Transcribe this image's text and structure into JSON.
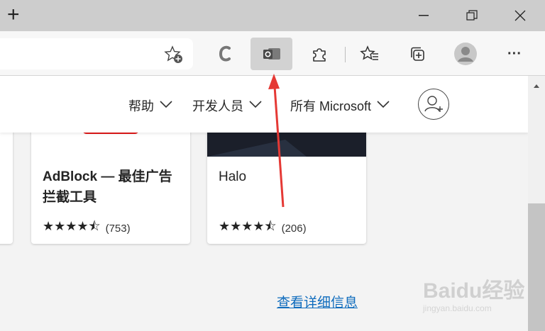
{
  "titlebar": {
    "new_tab": "+",
    "minimize": "—",
    "restore": "❐",
    "close": "✕"
  },
  "toolbar": {
    "more_label": "···",
    "colors": {
      "active_bg": "#d2d2d2",
      "outlook_blue": "#0078d4"
    }
  },
  "nav": {
    "help": "帮助",
    "developers": "开发人员",
    "all_microsoft": "所有 Microsoft"
  },
  "cards": [
    {
      "title": "AdBlock — 最佳广告拦截工具",
      "title_line1": "AdBlock — 最佳广告",
      "title_line2": "拦截工具",
      "rating": 4.5,
      "stars": "★★★★⯪",
      "count": "(753)"
    },
    {
      "title": "Halo",
      "rating": 4.5,
      "stars": "★★★★⯪",
      "count": "(206)"
    }
  ],
  "main": {
    "more_info_link": "查看详细信息"
  },
  "watermark": {
    "text": "Baidu经验",
    "sub": "jingyan.baidu.com"
  },
  "annotation": {
    "arrow_color": "#e53935"
  }
}
